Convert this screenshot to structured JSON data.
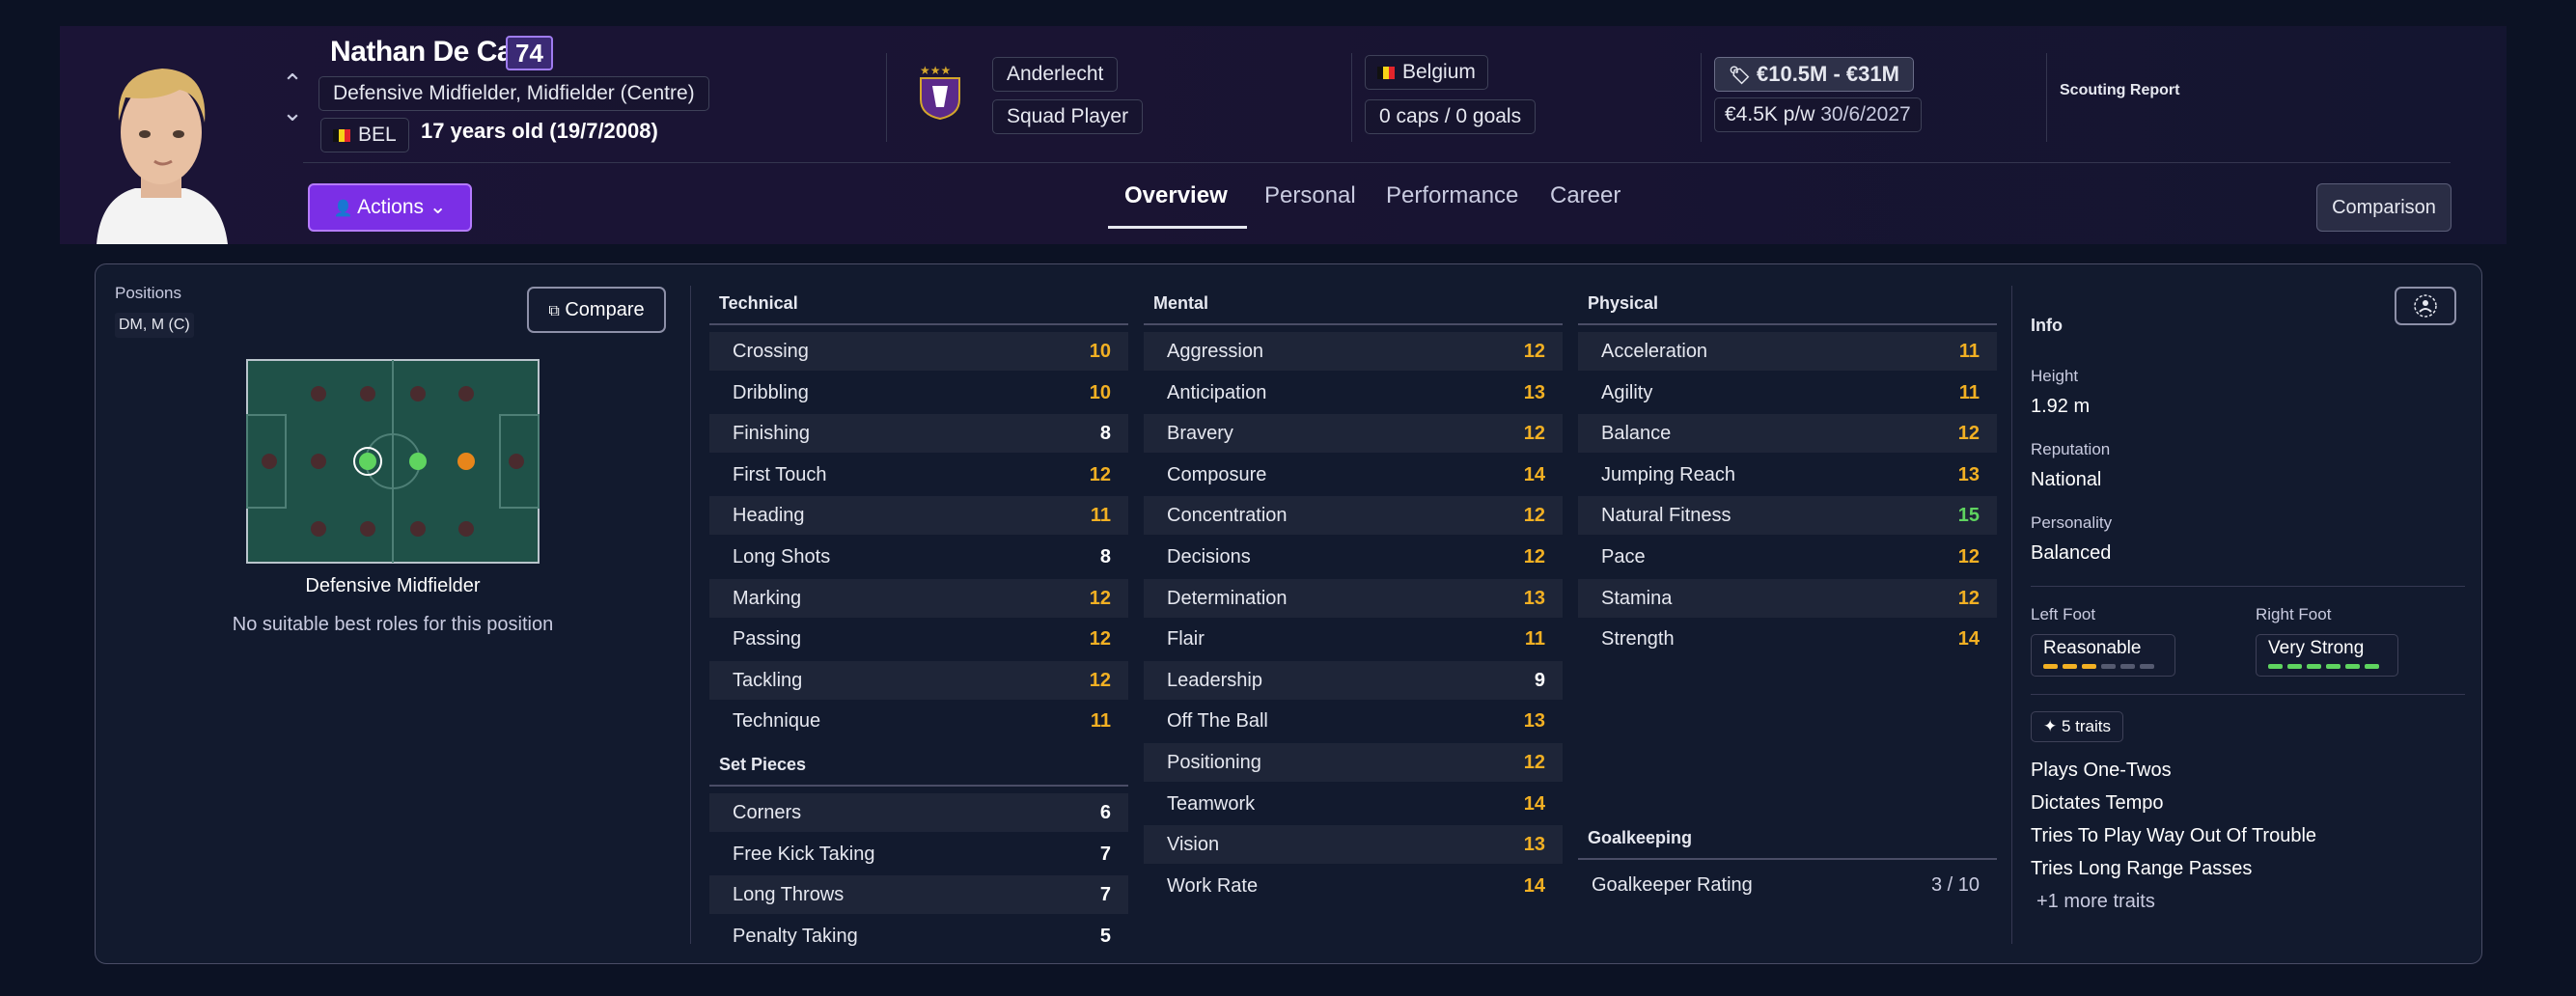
{
  "player": {
    "name": "Nathan De Cat",
    "ca": "74",
    "positions_full": "Defensive Midfielder, Midfielder (Centre)",
    "nationality": "BEL",
    "age": "17 years old (19/7/2008)"
  },
  "club": {
    "name": "Anderlecht",
    "status": "Squad Player"
  },
  "nation": {
    "name": "Belgium",
    "caps": "0 caps / 0 goals"
  },
  "value": {
    "range": "€10.5M - €31M",
    "wage": "€4.5K p/w",
    "contract_end": "30/6/2027"
  },
  "scouting_report": "Scouting Report",
  "header": {
    "actions_label": "Actions",
    "comparison_label": "Comparison"
  },
  "tabs": [
    {
      "label": "Overview"
    },
    {
      "label": "Personal"
    },
    {
      "label": "Performance"
    },
    {
      "label": "Career"
    }
  ],
  "positions_panel": {
    "title": "Positions",
    "value": "DM, M (C)",
    "compare_label": "Compare",
    "position_name": "Defensive Midfielder",
    "roles_note": "No suitable best roles for this position"
  },
  "technical": {
    "title": "Technical",
    "attributes": [
      {
        "name": "Crossing",
        "value": "10"
      },
      {
        "name": "Dribbling",
        "value": "10"
      },
      {
        "name": "Finishing",
        "value": "8"
      },
      {
        "name": "First Touch",
        "value": "12"
      },
      {
        "name": "Heading",
        "value": "11"
      },
      {
        "name": "Long Shots",
        "value": "8"
      },
      {
        "name": "Marking",
        "value": "12"
      },
      {
        "name": "Passing",
        "value": "12"
      },
      {
        "name": "Tackling",
        "value": "12"
      },
      {
        "name": "Technique",
        "value": "11"
      }
    ]
  },
  "set_pieces": {
    "title": "Set Pieces",
    "attributes": [
      {
        "name": "Corners",
        "value": "6"
      },
      {
        "name": "Free Kick Taking",
        "value": "7"
      },
      {
        "name": "Long Throws",
        "value": "7"
      },
      {
        "name": "Penalty Taking",
        "value": "5"
      }
    ]
  },
  "mental": {
    "title": "Mental",
    "attributes": [
      {
        "name": "Aggression",
        "value": "12"
      },
      {
        "name": "Anticipation",
        "value": "13"
      },
      {
        "name": "Bravery",
        "value": "12"
      },
      {
        "name": "Composure",
        "value": "14"
      },
      {
        "name": "Concentration",
        "value": "12"
      },
      {
        "name": "Decisions",
        "value": "12"
      },
      {
        "name": "Determination",
        "value": "13"
      },
      {
        "name": "Flair",
        "value": "11"
      },
      {
        "name": "Leadership",
        "value": "9"
      },
      {
        "name": "Off The Ball",
        "value": "13"
      },
      {
        "name": "Positioning",
        "value": "12"
      },
      {
        "name": "Teamwork",
        "value": "14"
      },
      {
        "name": "Vision",
        "value": "13"
      },
      {
        "name": "Work Rate",
        "value": "14"
      }
    ]
  },
  "physical": {
    "title": "Physical",
    "attributes": [
      {
        "name": "Acceleration",
        "value": "11"
      },
      {
        "name": "Agility",
        "value": "11"
      },
      {
        "name": "Balance",
        "value": "12"
      },
      {
        "name": "Jumping Reach",
        "value": "13"
      },
      {
        "name": "Natural Fitness",
        "value": "15"
      },
      {
        "name": "Pace",
        "value": "12"
      },
      {
        "name": "Stamina",
        "value": "12"
      },
      {
        "name": "Strength",
        "value": "14"
      }
    ]
  },
  "goalkeeping": {
    "title": "Goalkeeping",
    "rating_label": "Goalkeeper Rating",
    "rating_value": "3 / 10"
  },
  "info": {
    "title": "Info",
    "height_label": "Height",
    "height": "1.92 m",
    "reputation_label": "Reputation",
    "reputation": "National",
    "personality_label": "Personality",
    "personality": "Balanced",
    "left_foot_label": "Left Foot",
    "left_foot": "Reasonable",
    "left_foot_level": 0.5,
    "right_foot_label": "Right Foot",
    "right_foot": "Very Strong",
    "right_foot_level": 1.0,
    "traits_count": "5 traits",
    "traits": [
      "Plays One-Twos",
      "Dictates Tempo",
      "Tries To Play Way Out Of Trouble",
      "Tries Long Range Passes"
    ],
    "more_traits": "+1 more traits"
  },
  "colors": {
    "accent": "#7b2fe6",
    "attr_low": "#ffffff",
    "attr_mid": "#f2b023",
    "attr_high": "#5fd45f",
    "background": "#0c1224"
  }
}
